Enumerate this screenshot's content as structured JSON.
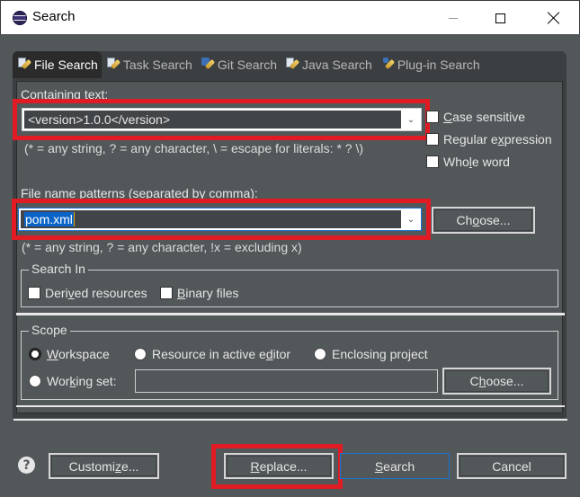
{
  "window": {
    "title": "Search",
    "controls": {
      "minimize": "—",
      "maximize": "☐",
      "close": "✕"
    }
  },
  "tabs": [
    {
      "label": "File Search",
      "icon": "file-search-icon",
      "active": true
    },
    {
      "label": "Task Search",
      "icon": "task-search-icon",
      "active": false
    },
    {
      "label": "Git Search",
      "icon": "git-search-icon",
      "active": false
    },
    {
      "label": "Java Search",
      "icon": "java-search-icon",
      "active": false
    },
    {
      "label": "Plug-in Search",
      "icon": "plugin-search-icon",
      "active": false
    }
  ],
  "containing_text": {
    "label": "Containing text:",
    "value": "<version>1.0.0</version>",
    "hint": "(* = any string, ? = any character, \\ = escape for literals: * ? \\)"
  },
  "options": {
    "case_sensitive": {
      "label": "Case sensitive",
      "mnemonic": "C",
      "rest": "ase sensitive",
      "checked": false
    },
    "regular_expression": {
      "label": "Regular expression",
      "pre": "Regular e",
      "mnemonic": "x",
      "rest": "pression",
      "checked": false
    },
    "whole_word": {
      "label": "Whole word",
      "pre": "Who",
      "mnemonic": "l",
      "rest": "e word",
      "checked": false
    }
  },
  "file_patterns": {
    "label": "File name patterns (separated by comma):",
    "value": "pom.xml",
    "hint": "(* = any string, ? = any character, !x = excluding x)",
    "choose_button": {
      "pre": "Ch",
      "mnemonic": "o",
      "rest": "ose..."
    }
  },
  "search_in": {
    "title": "Search In",
    "derived": {
      "pre": "Deri",
      "mnemonic": "v",
      "rest": "ed resources",
      "checked": false
    },
    "binary": {
      "pre": "",
      "mnemonic": "B",
      "rest": "inary files",
      "checked": false
    }
  },
  "scope": {
    "title": "Scope",
    "workspace": {
      "mnemonic": "W",
      "rest": "orkspace",
      "selected": true
    },
    "active_editor": {
      "pre": "Resource in active e",
      "mnemonic": "d",
      "rest": "itor",
      "selected": false
    },
    "enclosing_project": {
      "pre": "Enclosing pro",
      "mnemonic": "j",
      "rest": "ect",
      "selected": false
    },
    "working_set": {
      "pre": "Wor",
      "mnemonic": "k",
      "rest": "ing set:",
      "selected": false,
      "value": ""
    },
    "choose_button": {
      "pre": "C",
      "mnemonic": "h",
      "rest": "oose..."
    }
  },
  "footer": {
    "help_icon": "?",
    "customize": {
      "pre": "Customi",
      "mnemonic": "z",
      "rest": "e..."
    },
    "replace": {
      "pre": "",
      "mnemonic": "R",
      "rest": "eplace..."
    },
    "search": {
      "pre": "",
      "mnemonic": "S",
      "rest": "earch"
    },
    "cancel": {
      "label": "Cancel"
    }
  },
  "annotation_color": "#e01b24"
}
